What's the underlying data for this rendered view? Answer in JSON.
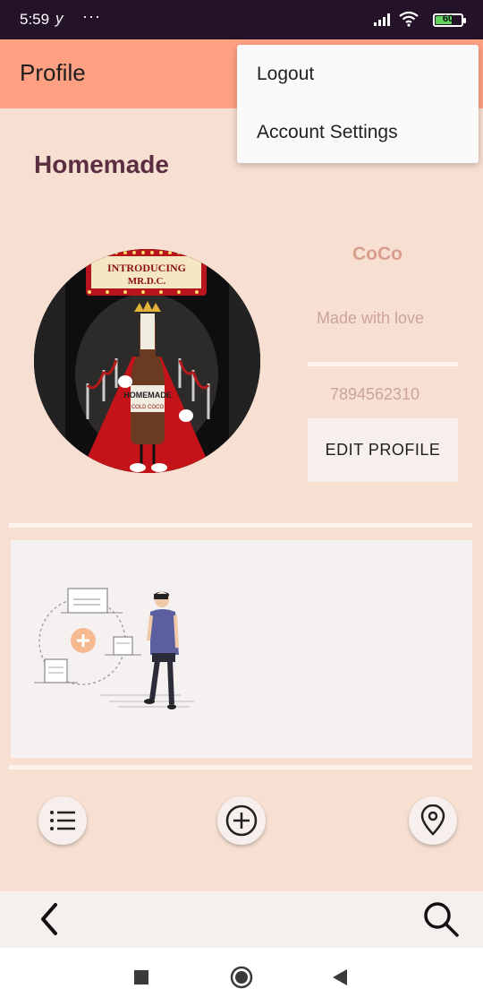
{
  "status_bar": {
    "time": "5:59",
    "carrier_glyph": "y",
    "dots": "···",
    "battery_level": "60",
    "icons": [
      "signal-icon",
      "wifi-icon",
      "battery-icon"
    ]
  },
  "app_bar": {
    "title": "Profile"
  },
  "overflow_menu": {
    "items": [
      {
        "label": "Logout"
      },
      {
        "label": "Account Settings"
      }
    ]
  },
  "profile": {
    "shop_name": "Homemade",
    "avatar_banner_line1": "INTRODUCING",
    "avatar_banner_line2": "MR.D.C.",
    "avatar_bottle_label": "HOMEMADE",
    "avatar_bottle_sub": "COLD COCO",
    "user_name": "CoCo",
    "bio": "Made with love",
    "phone": "7894562310",
    "edit_button_label": "EDIT PROFILE"
  },
  "actions": {
    "icons": [
      "list-icon",
      "add-circle-icon",
      "location-pin-icon"
    ]
  },
  "bottom_bar": {
    "icons": [
      "back-chevron-icon",
      "search-icon"
    ]
  },
  "system_nav": {
    "icons": [
      "recents-square-icon",
      "home-circle-icon",
      "back-triangle-icon"
    ]
  },
  "colors": {
    "status_bar": "#241228",
    "app_bar": "#ffa083",
    "background": "#f7e0d2",
    "shop_name": "#5a2d41",
    "accent_text": "#d79e8e"
  }
}
